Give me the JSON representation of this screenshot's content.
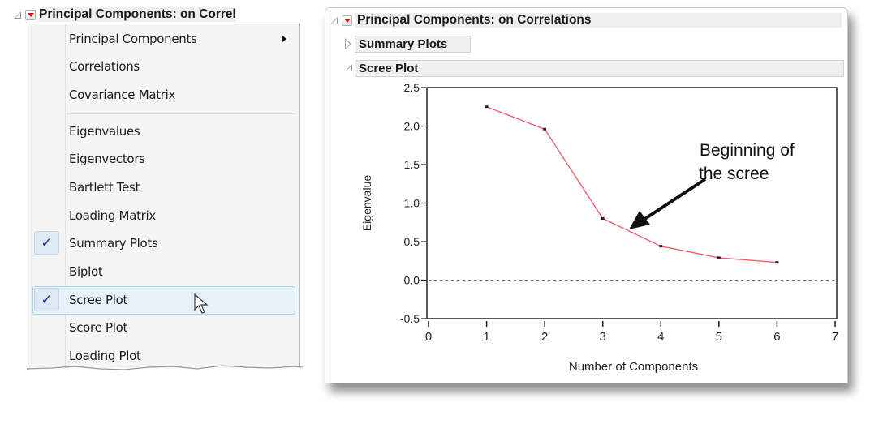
{
  "left_panel": {
    "header_title": "Principal Components: on Correl",
    "menu_items": [
      {
        "label": "Principal Components",
        "has_submenu": true,
        "checked": false
      },
      {
        "label": "Correlations",
        "checked": false
      },
      {
        "label": "Covariance Matrix",
        "checked": false
      },
      {
        "label": "Eigenvalues",
        "checked": false
      },
      {
        "label": "Eigenvectors",
        "checked": false
      },
      {
        "label": "Bartlett Test",
        "checked": false
      },
      {
        "label": "Loading Matrix",
        "checked": false
      },
      {
        "label": "Summary Plots",
        "checked": true
      },
      {
        "label": "Biplot",
        "checked": false
      },
      {
        "label": "Scree Plot",
        "checked": true,
        "hovered": true
      },
      {
        "label": "Score Plot",
        "checked": false
      },
      {
        "label": "Loading Plot",
        "checked": false
      }
    ],
    "check_glyph": "✓"
  },
  "report": {
    "header_title": "Principal Components: on Correlations",
    "sections": [
      {
        "label": "Summary Plots",
        "state": "collapsed"
      },
      {
        "label": "Scree Plot",
        "state": "expanded"
      }
    ]
  },
  "colors": {
    "line": "#f0606a",
    "point": "#222222",
    "check": "#1d2fa0",
    "menu_button": "#d01010"
  },
  "chart_data": {
    "type": "line",
    "title": "Scree Plot",
    "xlabel": "Number of Components",
    "ylabel": "Eigenvalue",
    "x": [
      1,
      2,
      3,
      4,
      5,
      6
    ],
    "series": [
      {
        "name": "Eigenvalue",
        "values": [
          2.25,
          1.96,
          0.8,
          0.44,
          0.29,
          0.23
        ]
      }
    ],
    "xlim": [
      0,
      7
    ],
    "ylim": [
      -0.5,
      2.5
    ],
    "xticks": [
      "0",
      "1",
      "2",
      "3",
      "4",
      "5",
      "6",
      "7"
    ],
    "yticks": [
      "2.5",
      "2.0",
      "1.5",
      "1.0",
      "0.5",
      "0.0",
      "-0.5"
    ],
    "ytick_values": [
      2.5,
      2.0,
      1.5,
      1.0,
      0.5,
      0.0,
      -0.5
    ],
    "reference_line": {
      "y": 0,
      "style": "dashed"
    },
    "annotation": {
      "line1": "Beginning of",
      "line2": "the scree",
      "points_to_x": 3.4
    },
    "grid": false
  }
}
